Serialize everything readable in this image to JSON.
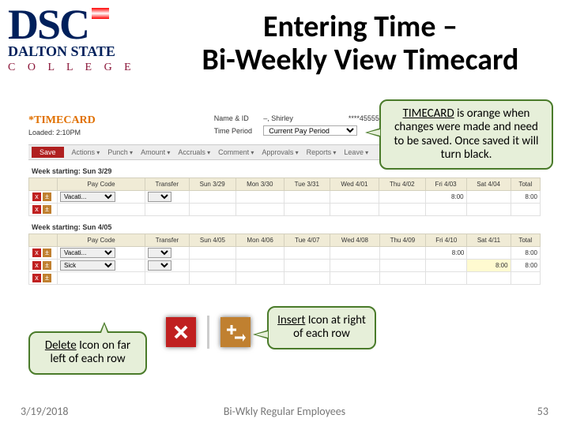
{
  "logo": {
    "dsc": "DSC",
    "dalton": "DALTON STATE",
    "college": "C O L L E G E"
  },
  "title_line1": "Entering Time –",
  "title_line2": "Bi-Weekly View Timecard",
  "callouts": {
    "timecard": {
      "u": "TIMECARD",
      "rest": " is orange when changes were made and need to be saved. Once saved it will turn black."
    },
    "insert": {
      "u": "Insert",
      "rest": " Icon at right of each row"
    },
    "delete": {
      "u": "Delete",
      "rest": " Icon on far left of each row"
    }
  },
  "tcard": {
    "timecard_label": "TIMECARD",
    "loaded": "Loaded: 2:10PM",
    "name_lbl": "Name & ID",
    "name_val": "–, Shirley",
    "id_val": "****45555",
    "tp_lbl": "Time Period",
    "tp_val": "Current Pay Period",
    "toolbar": {
      "save": "Save",
      "menus": [
        "Actions",
        "Punch",
        "Amount",
        "Accruals",
        "Comment",
        "Approvals",
        "Reports",
        "Leave"
      ]
    },
    "week1": {
      "label": "Week starting: Sun 3/29",
      "cols": [
        "Pay Code",
        "Transfer",
        "Sun 3/29",
        "Mon 3/30",
        "Tue 3/31",
        "Wed 4/01",
        "Thu 4/02",
        "Fri 4/03",
        "Sat 4/04",
        "Total"
      ],
      "rows": [
        {
          "paycode": "Vacati...",
          "cells": [
            "",
            "",
            "",
            "",
            "",
            "8:00",
            "",
            "",
            ""
          ],
          "total": "8:00"
        }
      ]
    },
    "week2": {
      "label": "Week starting: Sun 4/05",
      "cols": [
        "Pay Code",
        "Transfer",
        "Sun 4/05",
        "Mon 4/06",
        "Tue 4/07",
        "Wed 4/08",
        "Thu 4/09",
        "Fri 4/10",
        "Sat 4/11",
        "Total"
      ],
      "rows": [
        {
          "paycode": "Vacati...",
          "cells": [
            "",
            "",
            "",
            "",
            "",
            "8:00",
            "",
            "",
            ""
          ],
          "total": "8:00"
        },
        {
          "paycode": "Sick",
          "cells": [
            "",
            "",
            "",
            "",
            "",
            "",
            "8:00",
            "",
            ""
          ],
          "total": "8:00",
          "highlightCol": 6
        }
      ]
    }
  },
  "footer": {
    "date": "3/19/2018",
    "center": "Bi-Wkly Regular Employees",
    "page": "53"
  }
}
